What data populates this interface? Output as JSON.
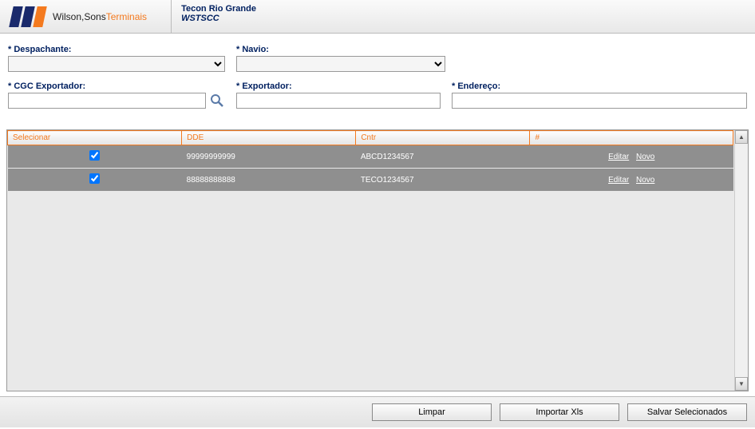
{
  "header": {
    "brand1": "Wilson,Sons",
    "brand2": "Terminais",
    "title": "Tecon Rio Grande",
    "subtitle": "WSTSCC"
  },
  "form": {
    "despachante_label": "* Despachante:",
    "navio_label": "* Navio:",
    "cgc_label": "* CGC Exportador:",
    "exportador_label": "* Exportador:",
    "endereco_label": "* Endereço:"
  },
  "grid": {
    "headers": {
      "selecionar": "Selecionar",
      "dde": "DDE",
      "cntr": "Cntr",
      "hash": "#"
    },
    "rows": [
      {
        "checked": true,
        "dde": "99999999999",
        "cntr": "ABCD1234567",
        "edit": "Editar",
        "novo": "Novo"
      },
      {
        "checked": true,
        "dde": "88888888888",
        "cntr": "TECO1234567",
        "edit": "Editar",
        "novo": "Novo"
      }
    ]
  },
  "footer": {
    "limpar": "Limpar",
    "importar": "Importar Xls",
    "salvar": "Salvar Selecionados"
  }
}
